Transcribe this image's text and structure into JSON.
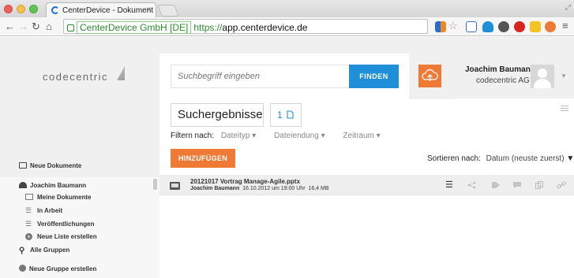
{
  "browser": {
    "tab_title": "CenterDevice - Dokument",
    "tab_close": "×",
    "ev_label": "CenterDevice GmbH [DE]",
    "url_scheme": "https://",
    "url_host": "app.centerdevice.de"
  },
  "header": {
    "logo_text": "codecentric",
    "search_placeholder": "Suchbegriff eingeben",
    "search_button": "FINDEN",
    "user_name": "Joachim Baumann",
    "user_org": "codecentric AG"
  },
  "sidebar": {
    "new_documents": "Neue Dokumente",
    "user_section": "Joachim Baumann",
    "sub_items": [
      "Meine Dokumente",
      "In Arbeit",
      "Veröffentlichungen",
      "Neue Liste erstellen"
    ],
    "all_groups": "Alle Gruppen",
    "new_group": "Neue Gruppe erstellen"
  },
  "main": {
    "title": "Suchergebnisse",
    "count": "1",
    "filter_label": "Filtern nach:",
    "filters": [
      "Dateityp",
      "Dateiendung",
      "Zeitraum"
    ],
    "add_button": "HINZUFÜGEN",
    "sort_label": "Sortieren nach:",
    "sort_value": "Datum (neuste zuerst)"
  },
  "results": [
    {
      "title": "20121017 Vortrag Manage-Agile.pptx",
      "author": "Joachim Baumann",
      "date": "16.10.2012 um 19:00 Uhr",
      "size": "16,4 MB"
    }
  ],
  "colors": {
    "accent_blue": "#1e8fd8",
    "accent_orange": "#ef7a35"
  }
}
